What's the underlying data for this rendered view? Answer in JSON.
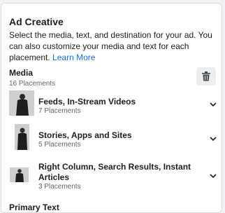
{
  "ad_creative": {
    "title": "Ad Creative",
    "description": "Select the media, text, and destination for your ad. You can also customize your media and text for each placement.",
    "learn_more": "Learn More"
  },
  "media": {
    "title": "Media",
    "count": "16 Placements"
  },
  "placements": [
    {
      "title": "Feeds, In-Stream Videos",
      "sub": "7 Placements",
      "icon": "chevron-down-icon"
    },
    {
      "title": "Stories, Apps and Sites",
      "sub": "5 Placements",
      "icon": "chevron-down-icon"
    },
    {
      "title": "Right Column, Search Results, Instant Articles",
      "sub": "3 Placements",
      "icon": "chevron-down-icon"
    }
  ],
  "primary_text": {
    "title": "Primary Text"
  },
  "icons": {
    "trash": "trash-icon"
  },
  "colors": {
    "link": "#216fdb",
    "muted": "#606770",
    "button_bg": "#ebedf0"
  }
}
